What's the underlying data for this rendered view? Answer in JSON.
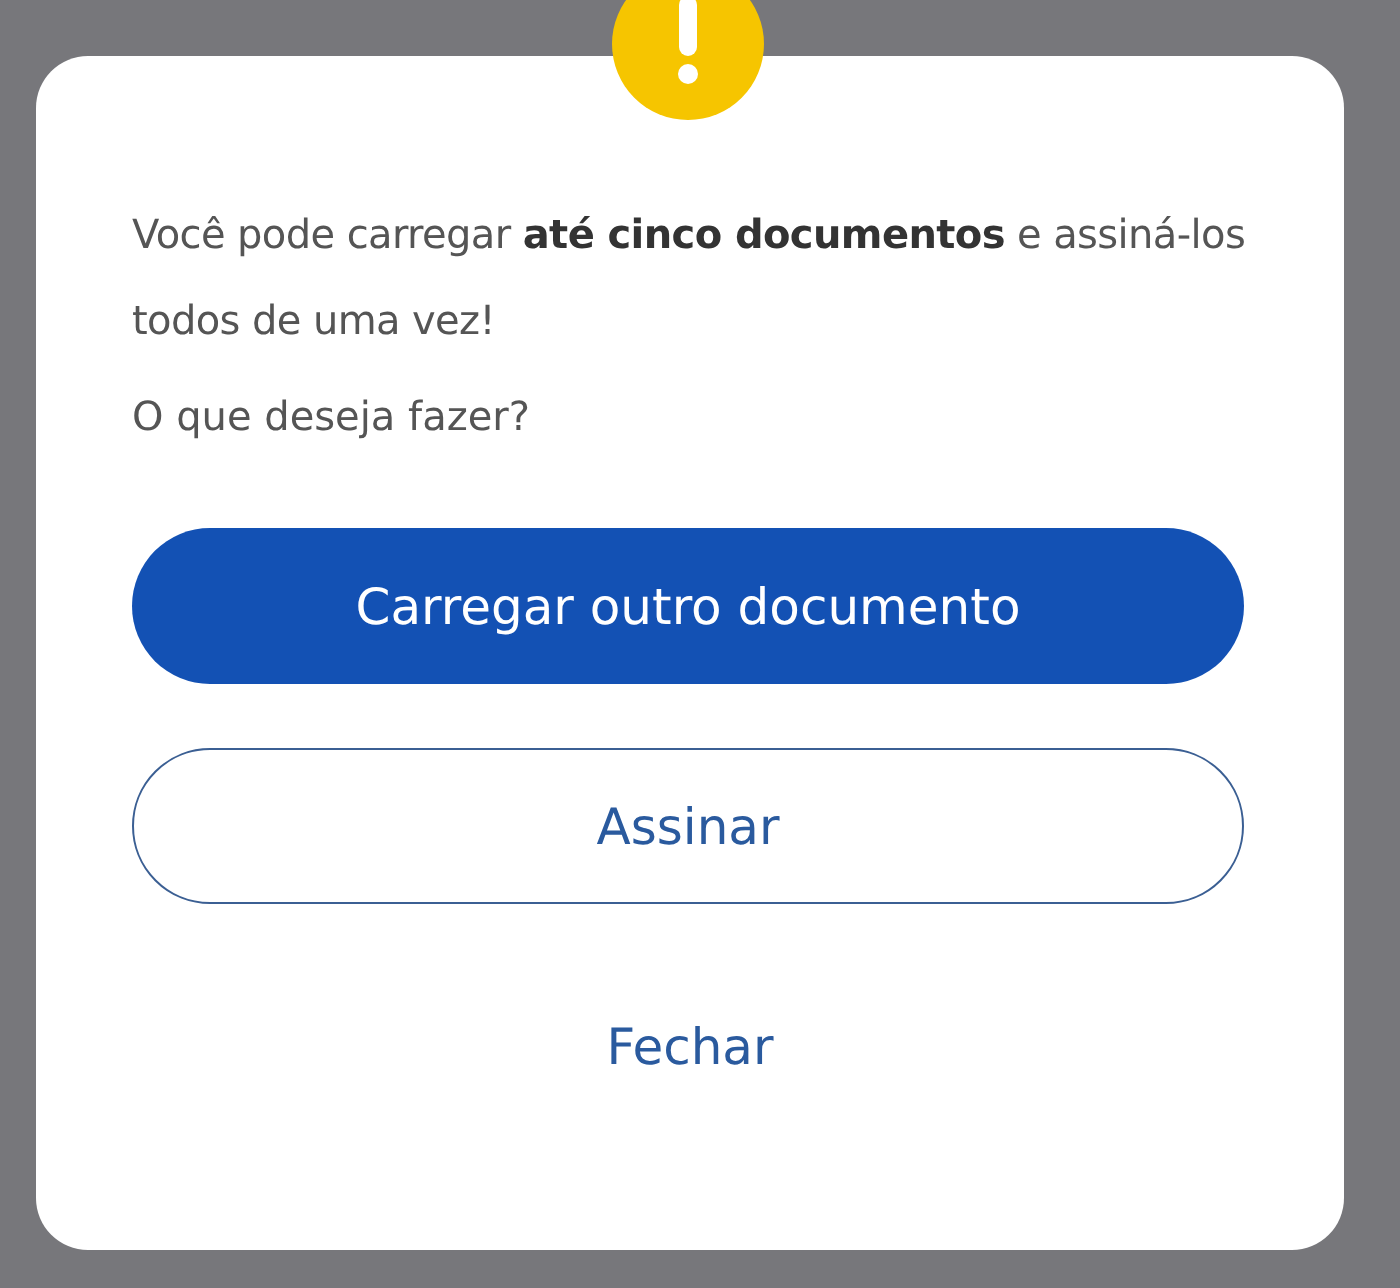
{
  "dialog": {
    "message": "Você pode carregar **até cinco documentos** e assiná-los todos de uma vez!",
    "question": "O que deseja fazer?",
    "buttons": [
      {
        "label": "Carregar outro documento",
        "kind": "primary"
      },
      {
        "label": "Assinar",
        "kind": "secondary"
      },
      {
        "label": "Fechar",
        "kind": "link"
      }
    ]
  }
}
